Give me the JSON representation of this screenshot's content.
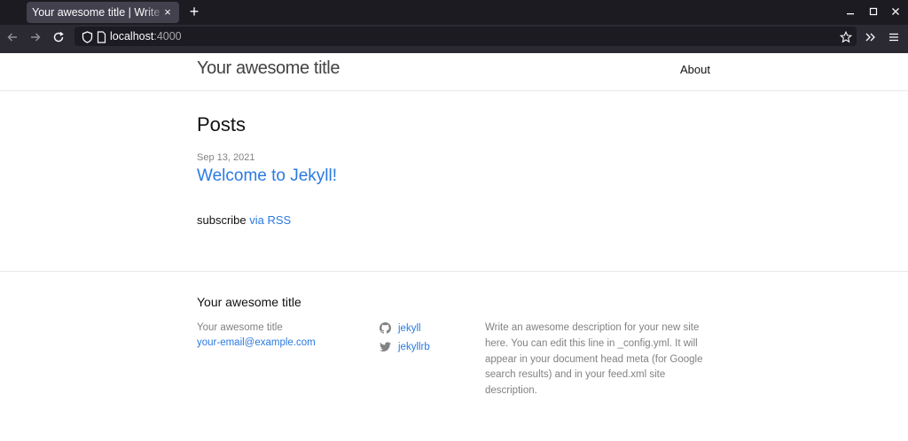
{
  "browser": {
    "tab_title": "Your awesome title | Write an awesome description for your new site here.",
    "tab_close": "×",
    "new_tab": "+",
    "url_host": "localhost",
    "url_port": ":4000",
    "icons": [
      "back-icon",
      "forward-icon",
      "reload-icon",
      "shield-icon",
      "page-icon",
      "bookmark-star-icon",
      "overflow-icon",
      "menu-icon"
    ]
  },
  "header": {
    "site_title": "Your awesome title",
    "nav_about": "About"
  },
  "main": {
    "heading": "Posts",
    "posts": [
      {
        "date": "Sep 13, 2021",
        "title": "Welcome to Jekyll!"
      }
    ],
    "subscribe_text": "subscribe",
    "subscribe_link": "via RSS"
  },
  "footer": {
    "heading": "Your awesome title",
    "name": "Your awesome title",
    "email": "your-email@example.com",
    "github": "jekyll",
    "twitter": "jekyllrb",
    "description": "Write an awesome description for your new site here. You can edit this line in _config.yml. It will appear in your document head meta (for Google search results) and in your feed.xml site description."
  },
  "colors": {
    "link": "#2a7ae2",
    "muted": "#828282",
    "chrome_dark": "#1c1b22",
    "chrome_toolbar": "#2b2a33"
  }
}
